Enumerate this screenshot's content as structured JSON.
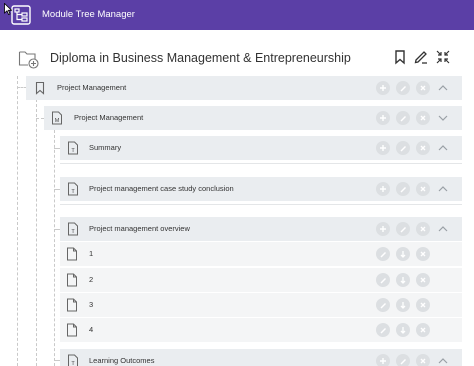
{
  "header": {
    "app_title": "Module Tree Manager"
  },
  "page": {
    "title": "Diploma in Business Management & Entrepreneurship"
  },
  "tree": {
    "root": {
      "label": "Project Management",
      "type": "bookmark",
      "state": "expanded"
    },
    "module": {
      "label": "Project Management",
      "type": "module",
      "badge": "M",
      "state": "collapsed"
    },
    "topics": [
      {
        "label": "Summary",
        "badge": "T",
        "state": "expanded"
      },
      {
        "label": "Project management case study conclusion",
        "badge": "T",
        "state": "expanded"
      },
      {
        "label": "Project management overview",
        "badge": "T",
        "state": "expanded"
      },
      {
        "label": "Learning Outcomes",
        "badge": "T",
        "state": "expanded"
      }
    ],
    "pages": [
      {
        "label": "1"
      },
      {
        "label": "2"
      },
      {
        "label": "3"
      },
      {
        "label": "4"
      }
    ]
  },
  "colors": {
    "header": "#5b3fa6",
    "row": "#eaedf0",
    "control": "#dcdfe2"
  }
}
